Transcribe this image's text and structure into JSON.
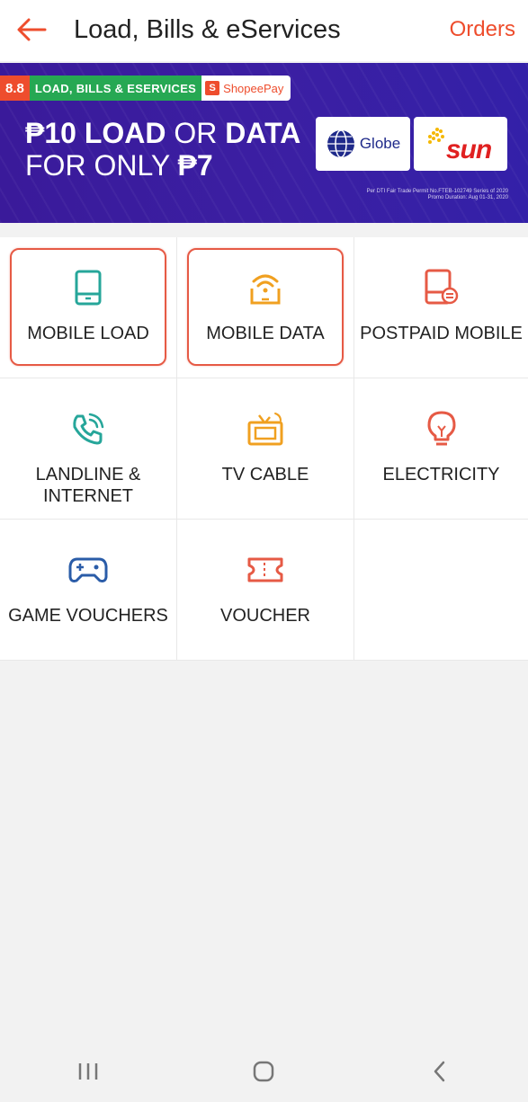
{
  "header": {
    "title": "Load, Bills & eServices",
    "orders_label": "Orders"
  },
  "banner": {
    "tag_number": "8.8",
    "tag_label": "LOAD, BILLS & ESERVICES",
    "pay_logo_letter": "S",
    "pay_label": "ShopeePay",
    "line1_bold_a": "₱10 LOAD",
    "line1_mid": " OR ",
    "line1_bold_b": "DATA",
    "line2_a": "FOR ONLY ",
    "line2_bold": "₱7",
    "brand_globe": "Globe",
    "brand_sun": "sun",
    "permit_line1": "Per DTI Fair Trade Permit No.FTEB-102749 Series of 2020",
    "permit_line2": "Promo Duration: Aug 01-31, 2020",
    "slide_count": 5,
    "active_slide": 1
  },
  "services": [
    {
      "label": "MOBILE LOAD",
      "icon": "mobile-phone-icon",
      "color": "#26a69a",
      "highlighted": true
    },
    {
      "label": "MOBILE DATA",
      "icon": "wifi-phone-icon",
      "color": "#f0a020",
      "highlighted": true
    },
    {
      "label": "POSTPAID MOBILE",
      "icon": "postpaid-phone-icon",
      "color": "#e65a45",
      "highlighted": false
    },
    {
      "label": "LANDLINE & INTERNET",
      "icon": "phone-call-icon",
      "color": "#26a69a",
      "highlighted": false
    },
    {
      "label": "TV CABLE",
      "icon": "tv-icon",
      "color": "#f0a020",
      "highlighted": false
    },
    {
      "label": "ELECTRICITY",
      "icon": "lightbulb-icon",
      "color": "#e65a45",
      "highlighted": false
    },
    {
      "label": "GAME VOUCHERS",
      "icon": "gamepad-icon",
      "color": "#2a5ca8",
      "highlighted": false
    },
    {
      "label": "VOUCHER",
      "icon": "ticket-icon",
      "color": "#e65a45",
      "highlighted": false
    }
  ],
  "colors": {
    "accent": "#ee4d2d",
    "banner_bg": "#3b1fa3"
  }
}
